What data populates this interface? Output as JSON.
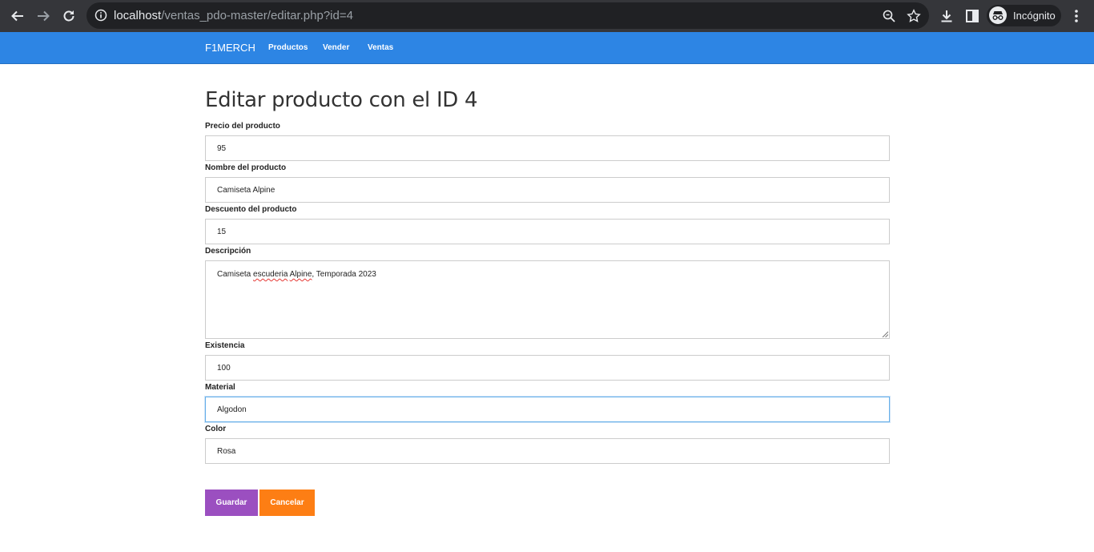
{
  "browser": {
    "url_host": "localhost",
    "url_path": "/ventas_pdo-master/editar.php?id=4",
    "incognito_label": "Incógnito",
    "icons": [
      "back-icon",
      "forward-icon",
      "reload-icon",
      "info-icon",
      "zoom-icon",
      "star-icon",
      "download-icon",
      "side-panel-icon",
      "incognito-icon",
      "menu-icon"
    ]
  },
  "navbar": {
    "brand": "F1MERCH",
    "links": [
      "Productos",
      "Vender",
      "Ventas"
    ],
    "color": "#2d85e4"
  },
  "form": {
    "title": "Editar producto con el ID 4",
    "fields": [
      {
        "label": "Precio del producto",
        "value": "95"
      },
      {
        "label": "Nombre del producto",
        "value": "Camiseta Alpine"
      },
      {
        "label": "Descuento del producto",
        "value": "15"
      },
      {
        "label": "Descripción",
        "value_before": "Camiseta ",
        "value_spell1": "escuderia",
        "value_mid": " ",
        "value_spell2": "Alpine",
        "value_after": ", Temporada 2023"
      },
      {
        "label": "Existencia",
        "value": "100"
      },
      {
        "label": "Material",
        "value": "Algodon"
      },
      {
        "label": "Color",
        "value": "Rosa"
      }
    ],
    "save_label": "Guardar",
    "cancel_label": "Cancelar",
    "save_color": "#9b4fc0",
    "cancel_color": "#fd7e14"
  }
}
